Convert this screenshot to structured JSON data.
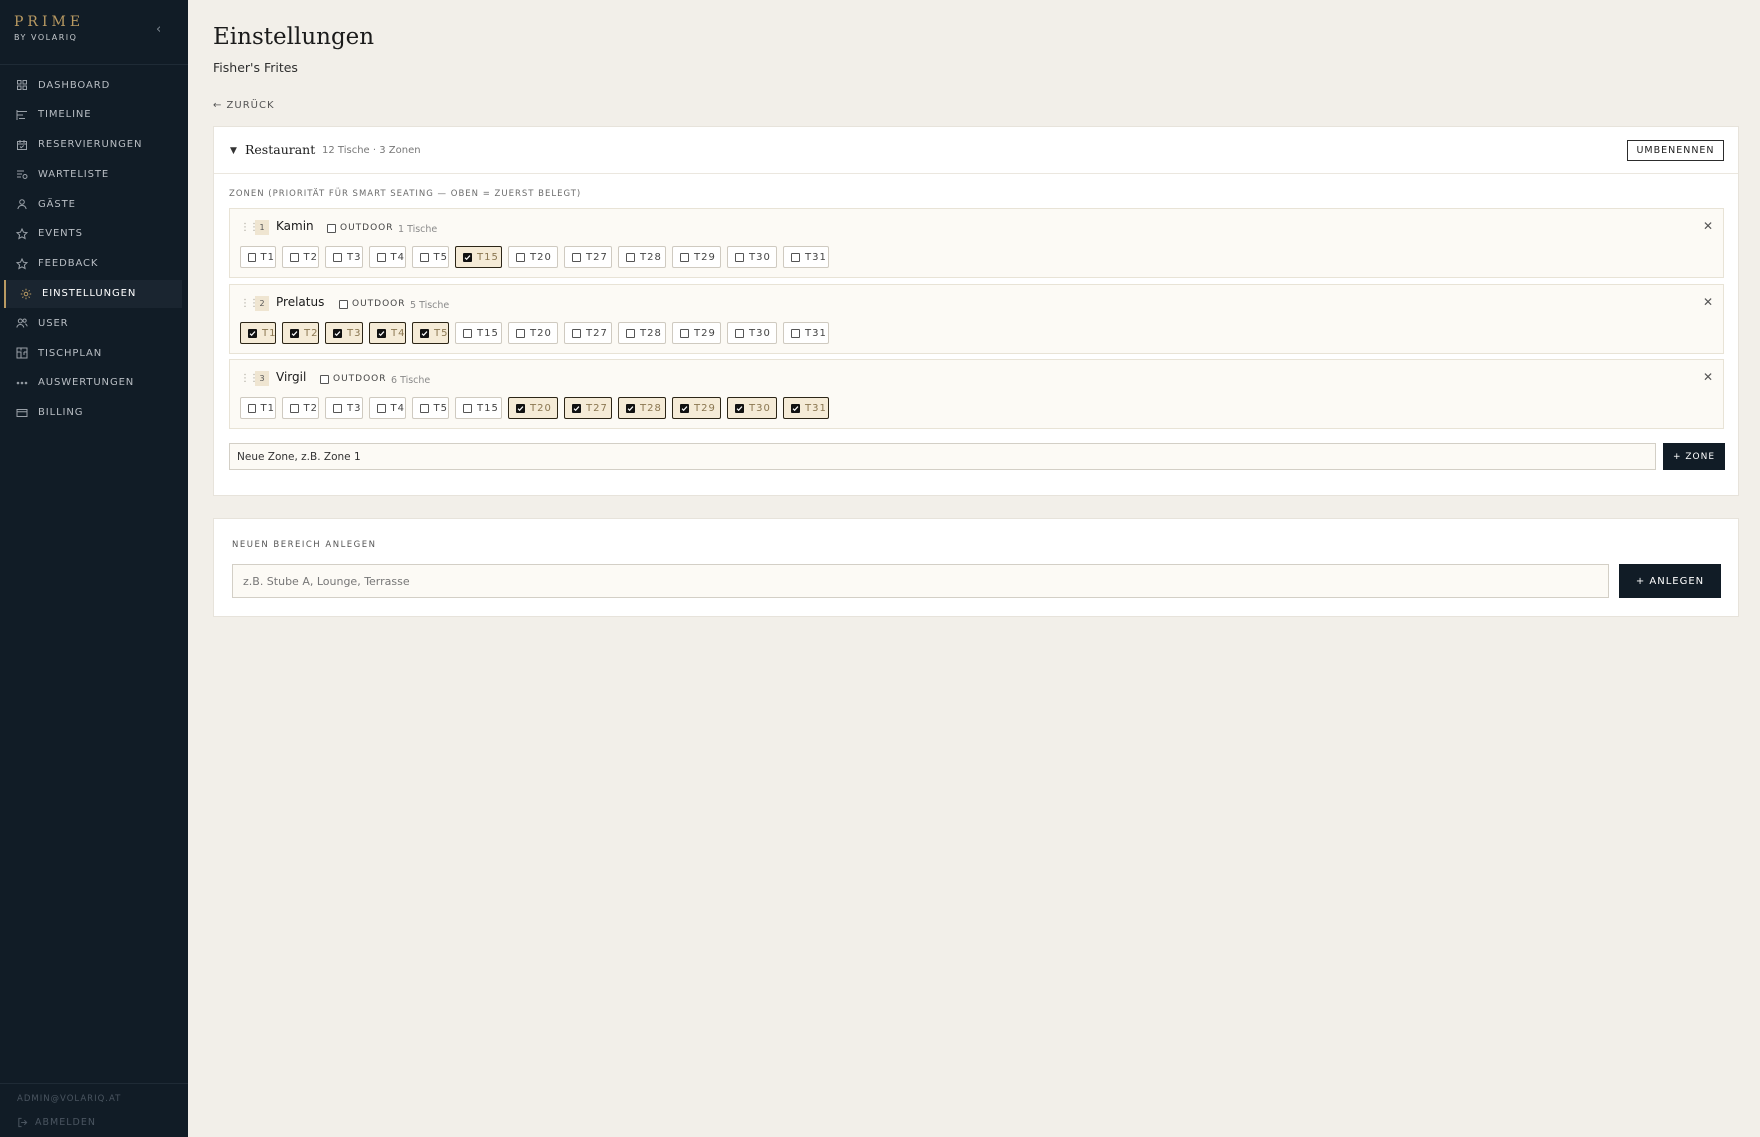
{
  "brand": {
    "title": "PRIME",
    "subtitle": "BY VOLARIQ"
  },
  "sidebar": {
    "collapse_glyph": "‹",
    "items": [
      {
        "label": "DASHBOARD",
        "icon": "grid-icon"
      },
      {
        "label": "TIMELINE",
        "icon": "timeline-icon"
      },
      {
        "label": "RESERVIERUNGEN",
        "icon": "calendar-icon"
      },
      {
        "label": "WARTELISTE",
        "icon": "waitlist-icon"
      },
      {
        "label": "GÄSTE",
        "icon": "person-icon"
      },
      {
        "label": "EVENTS",
        "icon": "star-icon"
      },
      {
        "label": "FEEDBACK",
        "icon": "star-icon"
      },
      {
        "label": "EINSTELLUNGEN",
        "icon": "gear-icon",
        "active": true
      },
      {
        "label": "USER",
        "icon": "users-icon"
      },
      {
        "label": "TISCHPLAN",
        "icon": "floorplan-icon"
      },
      {
        "label": "AUSWERTUNGEN",
        "icon": "dots-icon"
      },
      {
        "label": "BILLING",
        "icon": "card-icon"
      }
    ],
    "user_email": "ADMIN@VOLARIQ.AT",
    "logout_label": "ABMELDEN"
  },
  "page": {
    "title": "Einstellungen",
    "subtitle": "Fisher's Frites",
    "back_label": "← ZURÜCK"
  },
  "area": {
    "caret": "▼",
    "name": "Restaurant",
    "meta": "12 Tische · 3 Zonen",
    "rename_label": "UMBENENNEN",
    "zones_heading": "ZONEN (PRIORITÄT FÜR SMART SEATING — OBEN = ZUERST BELEGT)",
    "zones": [
      {
        "index": "1",
        "name": "Kamin",
        "outdoor_label": "OUTDOOR",
        "outdoor": false,
        "count": "1 Tische",
        "selected": [
          "T15"
        ]
      },
      {
        "index": "2",
        "name": "Prelatus",
        "outdoor_label": "OUTDOOR",
        "outdoor": false,
        "count": "5 Tische",
        "selected": [
          "T1",
          "T2",
          "T3",
          "T4",
          "T5"
        ]
      },
      {
        "index": "3",
        "name": "Virgil",
        "outdoor_label": "OUTDOOR",
        "outdoor": false,
        "count": "6 Tische",
        "selected": [
          "T20",
          "T27",
          "T28",
          "T29",
          "T30",
          "T31"
        ]
      }
    ],
    "tables": [
      "T1",
      "T2",
      "T3",
      "T4",
      "T5",
      "T15",
      "T20",
      "T27",
      "T28",
      "T29",
      "T30",
      "T31"
    ],
    "new_zone_placeholder": "Neue Zone, z.B. Zone 1",
    "add_zone_label": "+ ZONE"
  },
  "new_area": {
    "heading": "NEUEN BEREICH ANLEGEN",
    "placeholder": "z.B. Stube A, Lounge, Terrasse",
    "create_label": "+ ANLEGEN"
  },
  "colors": {
    "sidebar_bg": "#111c26",
    "accent": "#b99a62",
    "page_bg": "#f2efe9",
    "selected_chip_bg": "#f5ebd7"
  }
}
